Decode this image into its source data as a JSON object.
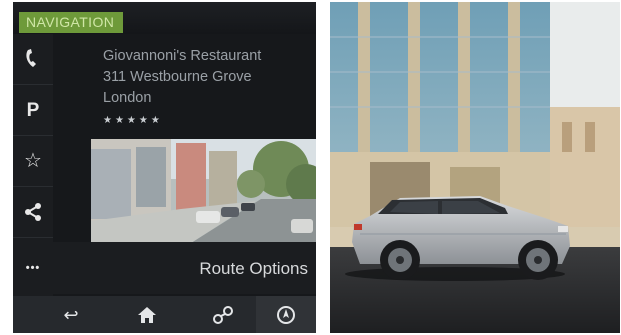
{
  "header": {
    "badge_label": "NAVIGATION"
  },
  "side_rail": {
    "items": [
      {
        "icon": "phone-icon",
        "glyph": "✆"
      },
      {
        "icon": "parking-icon",
        "glyph": "P"
      },
      {
        "icon": "star-icon",
        "glyph": "☆"
      },
      {
        "icon": "share-icon",
        "glyph": "<"
      },
      {
        "icon": "more-icon",
        "glyph": "•••"
      }
    ]
  },
  "poi": {
    "name": "Giovannoni's Restaurant",
    "address_line1": "311 Westbourne Grove",
    "address_line2": "London",
    "rating_stars": "★★★★★"
  },
  "route": {
    "label": "Route Options"
  },
  "bottom_bar": {
    "items": [
      {
        "icon": "back-icon",
        "glyph": "↩"
      },
      {
        "icon": "home-icon",
        "glyph": "⌂"
      },
      {
        "icon": "route-icon",
        "glyph": "⚯"
      },
      {
        "icon": "compass-icon",
        "glyph": "⊚"
      }
    ]
  },
  "colors": {
    "screen_bg": "#16181b",
    "badge_bg": "#6e9a3a",
    "text_dim": "#9aa0a6",
    "car_silver": "#b8bcc0"
  }
}
